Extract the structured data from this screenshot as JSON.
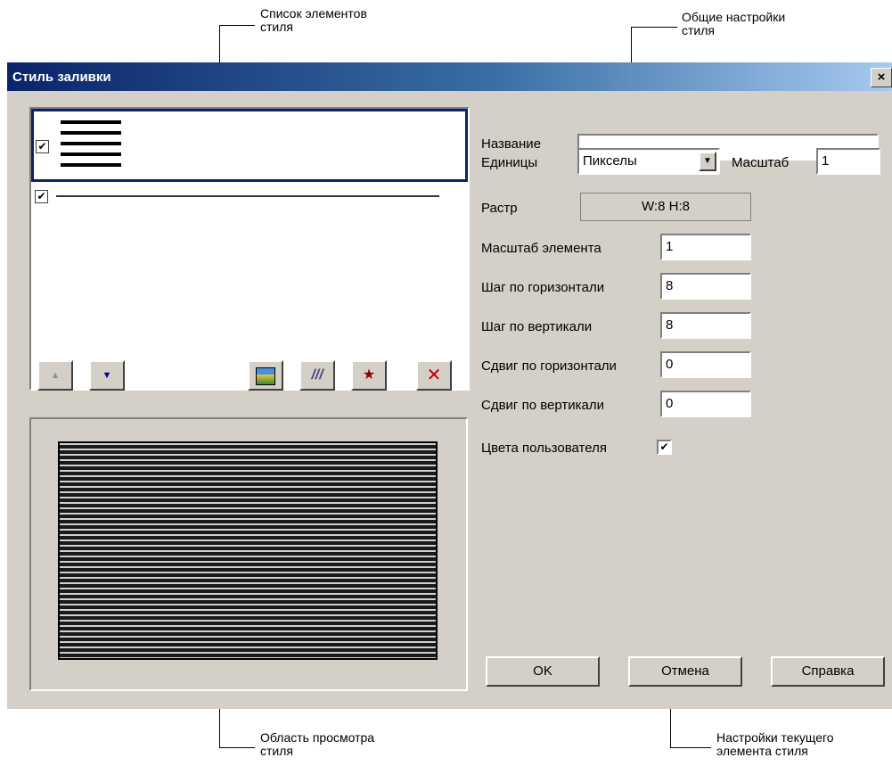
{
  "callouts": {
    "style_elements_list": "Список элементов\nстиля",
    "general_settings": "Общие настройки\nстиля",
    "preview_area": "Область просмотра\nстиля",
    "current_element_settings": "Настройки текущего\nэлемента стиля"
  },
  "dialog": {
    "title": "Стиль заливки",
    "close_label": "×"
  },
  "element_list": {
    "items": [
      {
        "checked": true,
        "selected": true,
        "preview": "hatch"
      },
      {
        "checked": true,
        "selected": false,
        "preview": "line"
      }
    ],
    "check_glyph": "✔"
  },
  "toolbar": {
    "up_glyph": "▲",
    "down_glyph": "▼",
    "image_icon": "image-icon",
    "hatch_glyph": "///",
    "star_glyph": "★",
    "delete_glyph": "✕"
  },
  "general": {
    "name_label": "Название",
    "name_value": "",
    "units_label": "Единицы",
    "units_value": "Пикселы",
    "scale_label": "Масштаб",
    "scale_value": "1",
    "raster_label": "Растр",
    "raster_value": "W:8  H:8"
  },
  "element": {
    "element_scale_label": "Масштаб элемента",
    "element_scale_value": "1",
    "h_step_label": "Шаг по горизонтали",
    "h_step_value": "8",
    "v_step_label": "Шаг по вертикали",
    "v_step_value": "8",
    "h_shift_label": "Сдвиг по горизонтали",
    "h_shift_value": "0",
    "v_shift_label": "Сдвиг по вертикали",
    "v_shift_value": "0",
    "user_colors_label": "Цвета пользователя",
    "user_colors_checked": true
  },
  "buttons": {
    "ok": "OK",
    "cancel": "Отмена",
    "help": "Справка"
  },
  "colors": {
    "title_gradient_start": "#0a246a",
    "dialog_bg": "#d4d0c8",
    "star": "#8b0000",
    "delete": "#c00000",
    "down_arrow": "#00008b"
  }
}
